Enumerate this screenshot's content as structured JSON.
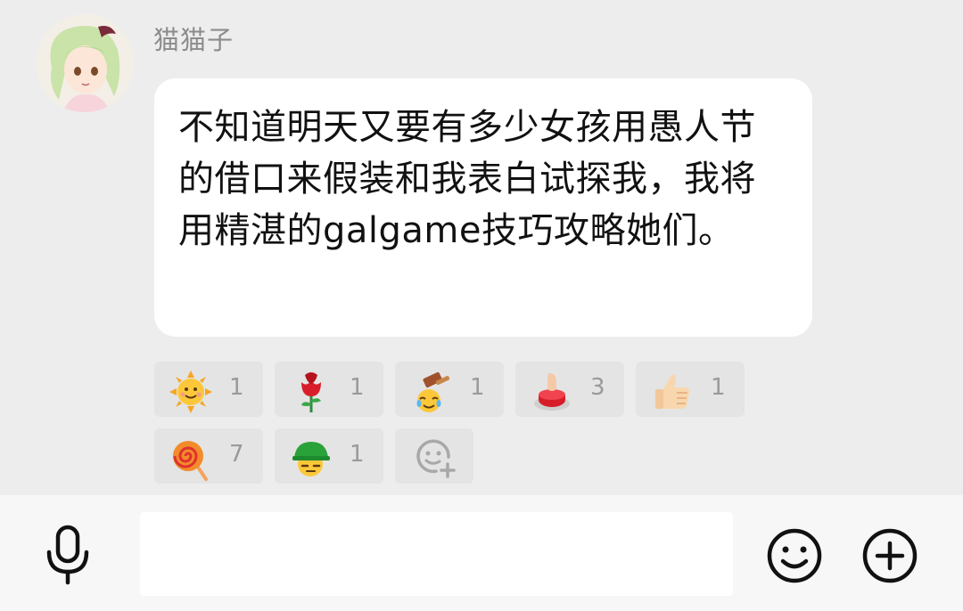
{
  "message": {
    "sender": "猫猫子",
    "text": "不知道明天又要有多少女孩用愚人节的借口来假装和我表白试探我，我将用精湛的galgame技巧攻略她们。"
  },
  "reactions": [
    {
      "icon": "sun-emoji-icon",
      "count": "1"
    },
    {
      "icon": "rose-emoji-icon",
      "count": "1"
    },
    {
      "icon": "hammer-emoji-icon",
      "count": "1"
    },
    {
      "icon": "red-button-emoji-icon",
      "count": "3"
    },
    {
      "icon": "thumbs-up-emoji-icon",
      "count": "1"
    },
    {
      "icon": "lollipop-emoji-icon",
      "count": "7"
    },
    {
      "icon": "green-hat-emoji-icon",
      "count": "1"
    }
  ],
  "input_bar": {
    "placeholder": ""
  },
  "colors": {
    "chat_background": "#ededed",
    "bubble": "#ffffff",
    "reaction_chip": "#e4e4e4",
    "input_bar": "#f7f7f7"
  }
}
